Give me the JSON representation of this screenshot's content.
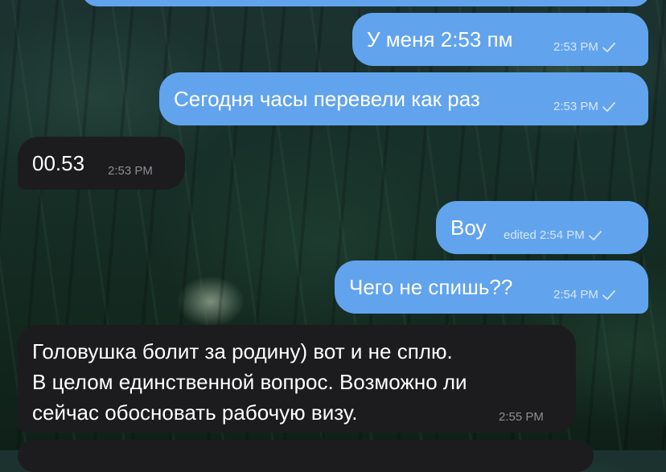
{
  "messages": [
    {
      "id": "m1",
      "direction": "outgoing",
      "text": "У меня 2:53 пм",
      "time": "2:53 PM",
      "status_icon": "check-icon"
    },
    {
      "id": "m2",
      "direction": "outgoing",
      "text": "Сегодня часы перевели как раз",
      "time": "2:53 PM",
      "status_icon": "check-icon"
    },
    {
      "id": "m3",
      "direction": "incoming",
      "text": "00.53",
      "time": "2:53 PM"
    },
    {
      "id": "m4",
      "direction": "outgoing",
      "text": "Воу",
      "edited_label": "edited",
      "time": "2:54 PM",
      "status_icon": "check-icon"
    },
    {
      "id": "m5",
      "direction": "outgoing",
      "text": "Чего не спишь??",
      "time": "2:54 PM",
      "status_icon": "check-icon"
    },
    {
      "id": "m6",
      "direction": "incoming",
      "lines": [
        "Головушка болит за родину) вот и не сплю.",
        "В целом единственной вопрос. Возможно ли",
        "сейчас обосновать рабочую визу."
      ],
      "time": "2:55 PM"
    }
  ],
  "colors": {
    "outgoing_bubble": "#62a3ee",
    "incoming_bubble": "#1c1c1e",
    "outgoing_meta": "#d5e6fb",
    "incoming_meta": "#8e8e93",
    "background_theme": "dark forest"
  }
}
